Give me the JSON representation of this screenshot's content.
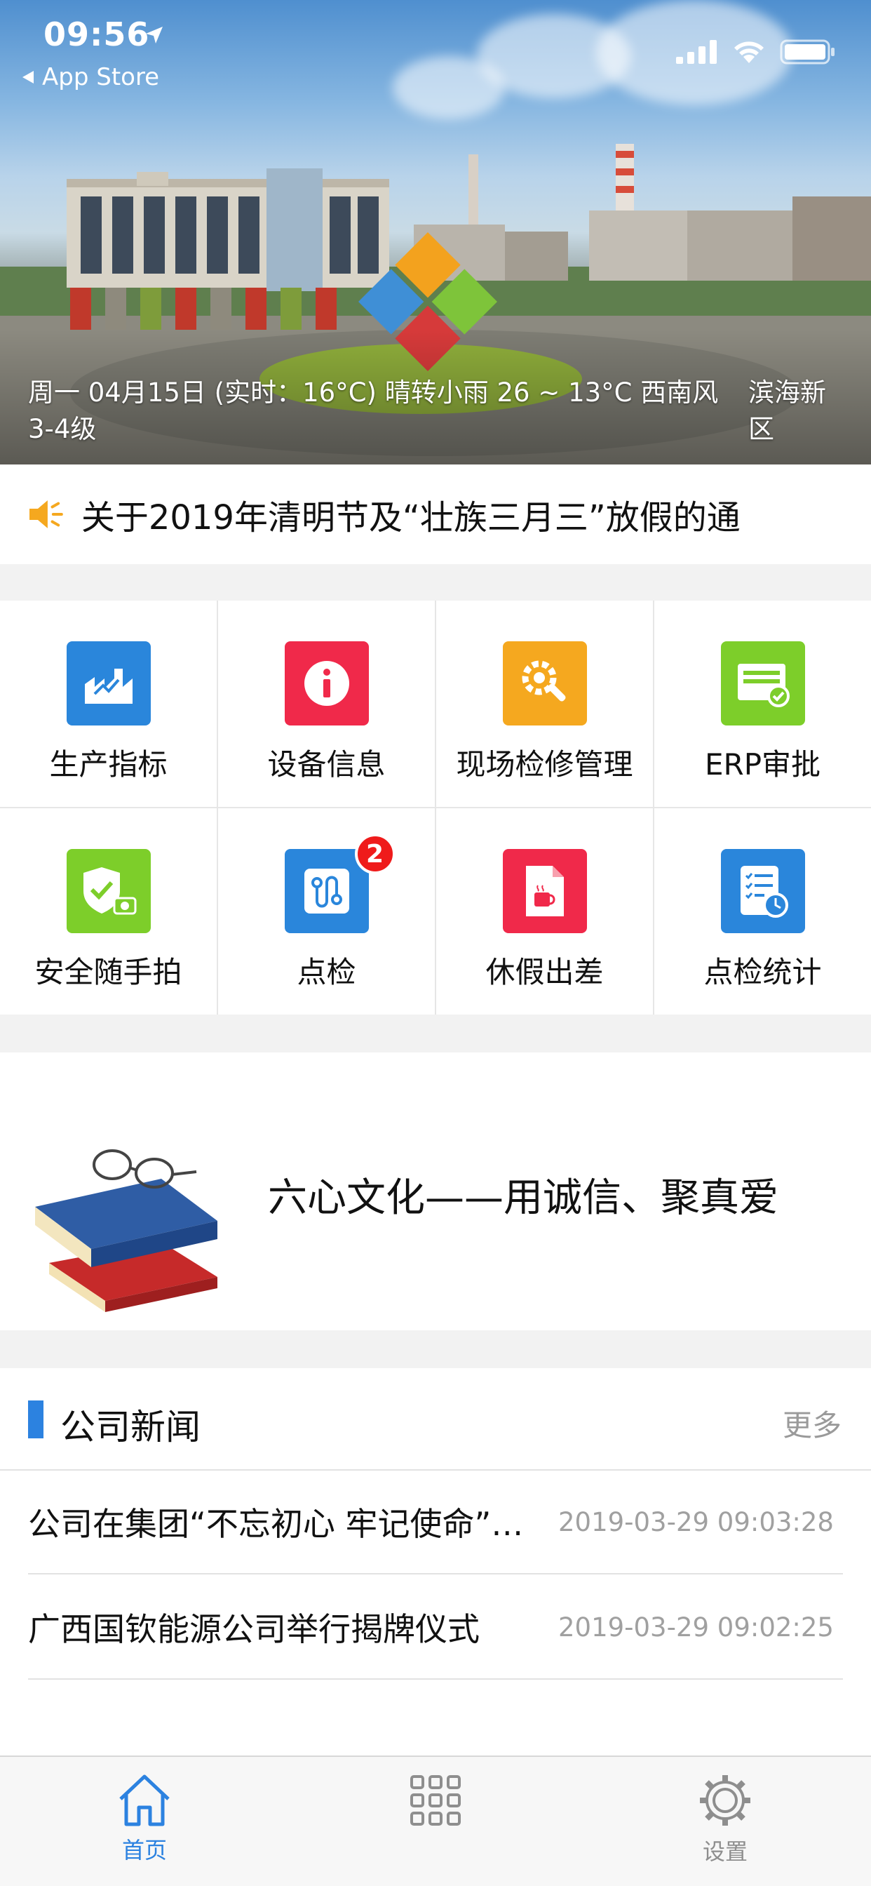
{
  "status_bar": {
    "time": "09:56",
    "back_label": "App Store"
  },
  "hero": {
    "weather_main": "周一 04月15日 (实时：16°C) 晴转小雨 26 ~ 13°C 西南风3-4级",
    "weather_area": "滨海新区"
  },
  "notice": {
    "text": "关于2019年清明节及“壮族三月三”放假的通"
  },
  "grid": {
    "items": [
      {
        "label": "生产指标",
        "icon": "factory-chart-icon",
        "color": "#2a86db"
      },
      {
        "label": "设备信息",
        "icon": "info-icon",
        "color": "#f0294a"
      },
      {
        "label": "现场检修管理",
        "icon": "wrench-gear-icon",
        "color": "#f5a81f"
      },
      {
        "label": "ERP审批",
        "icon": "approval-card-icon",
        "color": "#7dce2a"
      },
      {
        "label": "安全随手拍",
        "icon": "shield-camera-icon",
        "color": "#7dce2a"
      },
      {
        "label": "点检",
        "icon": "route-check-icon",
        "color": "#2a86db",
        "badge": "2"
      },
      {
        "label": "休假出差",
        "icon": "coffee-document-icon",
        "color": "#f0294a"
      },
      {
        "label": "点检统计",
        "icon": "checklist-clock-icon",
        "color": "#2a86db"
      }
    ]
  },
  "culture": {
    "text": "六心文化——用诚信、聚真爱"
  },
  "news": {
    "title": "公司新闻",
    "more": "更多",
    "items": [
      {
        "title": "公司在集团“不忘初心 牢记使命”主题教育活动中",
        "date": "2019-03-29 09:03:28"
      },
      {
        "title": "广西国钦能源公司举行揭牌仪式",
        "date": "2019-03-29 09:02:25"
      }
    ]
  },
  "tabbar": {
    "items": [
      {
        "label": "首页",
        "icon": "home-icon",
        "active": true
      },
      {
        "label": "",
        "icon": "grid-icon",
        "active": false
      },
      {
        "label": "设置",
        "icon": "gear-icon",
        "active": false
      }
    ],
    "active_color": "#2c82e0",
    "inactive_color": "#8e8e8e"
  }
}
